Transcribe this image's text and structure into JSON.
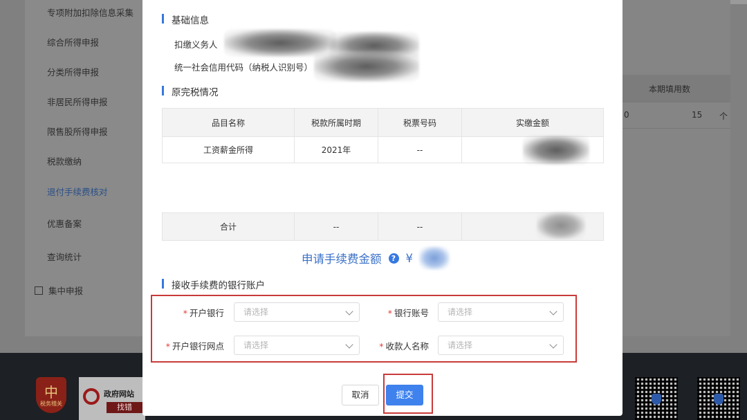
{
  "background": {
    "sidebar_items": [
      {
        "label": "专项附加扣除信息采集",
        "active": false
      },
      {
        "label": "综合所得申报",
        "active": false
      },
      {
        "label": "分类所得申报",
        "active": false
      },
      {
        "label": "非居民所得申报",
        "active": false
      },
      {
        "label": "限售股所得申报",
        "active": false
      },
      {
        "label": "税款缴纳",
        "active": false
      },
      {
        "label": "退付手续费核对",
        "active": true
      },
      {
        "label": "优惠备案",
        "active": false
      },
      {
        "label": "查询统计",
        "active": false
      },
      {
        "label": "集中申报",
        "active": false
      }
    ],
    "table": {
      "header": "本期填用数",
      "cell_partial": "0",
      "cell_value": "15",
      "cell_arrow": "个"
    },
    "footer": {
      "emblem_text": "税务稽关",
      "gov_top": "政府网站",
      "gov_bottom": "找错"
    }
  },
  "modal": {
    "basic_info_title": "基础信息",
    "withholding_agent_label": "扣缴义务人",
    "credit_code_label": "统一社会信用代码（纳税人识别号）",
    "tax_status_title": "原完税情况",
    "table": {
      "columns": [
        "品目名称",
        "税款所属时期",
        "税票号码",
        "实缴金额"
      ],
      "rows": [
        {
          "item": "工资薪金所得",
          "period": "2021年",
          "ticket": "--",
          "amount": ""
        }
      ],
      "total": {
        "item": "合计",
        "period": "--",
        "ticket": "--",
        "amount": ""
      }
    },
    "fee_label": "申请手续费金额",
    "fee_help": "?",
    "fee_currency": "¥",
    "bank_title": "接收手续费的银行账户",
    "fields": {
      "bank": {
        "label": "开户银行",
        "placeholder": "请选择"
      },
      "account": {
        "label": "银行账号",
        "placeholder": "请选择"
      },
      "branch": {
        "label": "开户银行网点",
        "placeholder": "请选择"
      },
      "payee": {
        "label": "收款人名称",
        "placeholder": "请选择"
      }
    },
    "required_mark": "*",
    "cancel_label": "取消",
    "submit_label": "提交"
  },
  "colors": {
    "accent": "#3f82ee",
    "highlight_frame": "#c93a3a",
    "required": "#e23b3b"
  }
}
